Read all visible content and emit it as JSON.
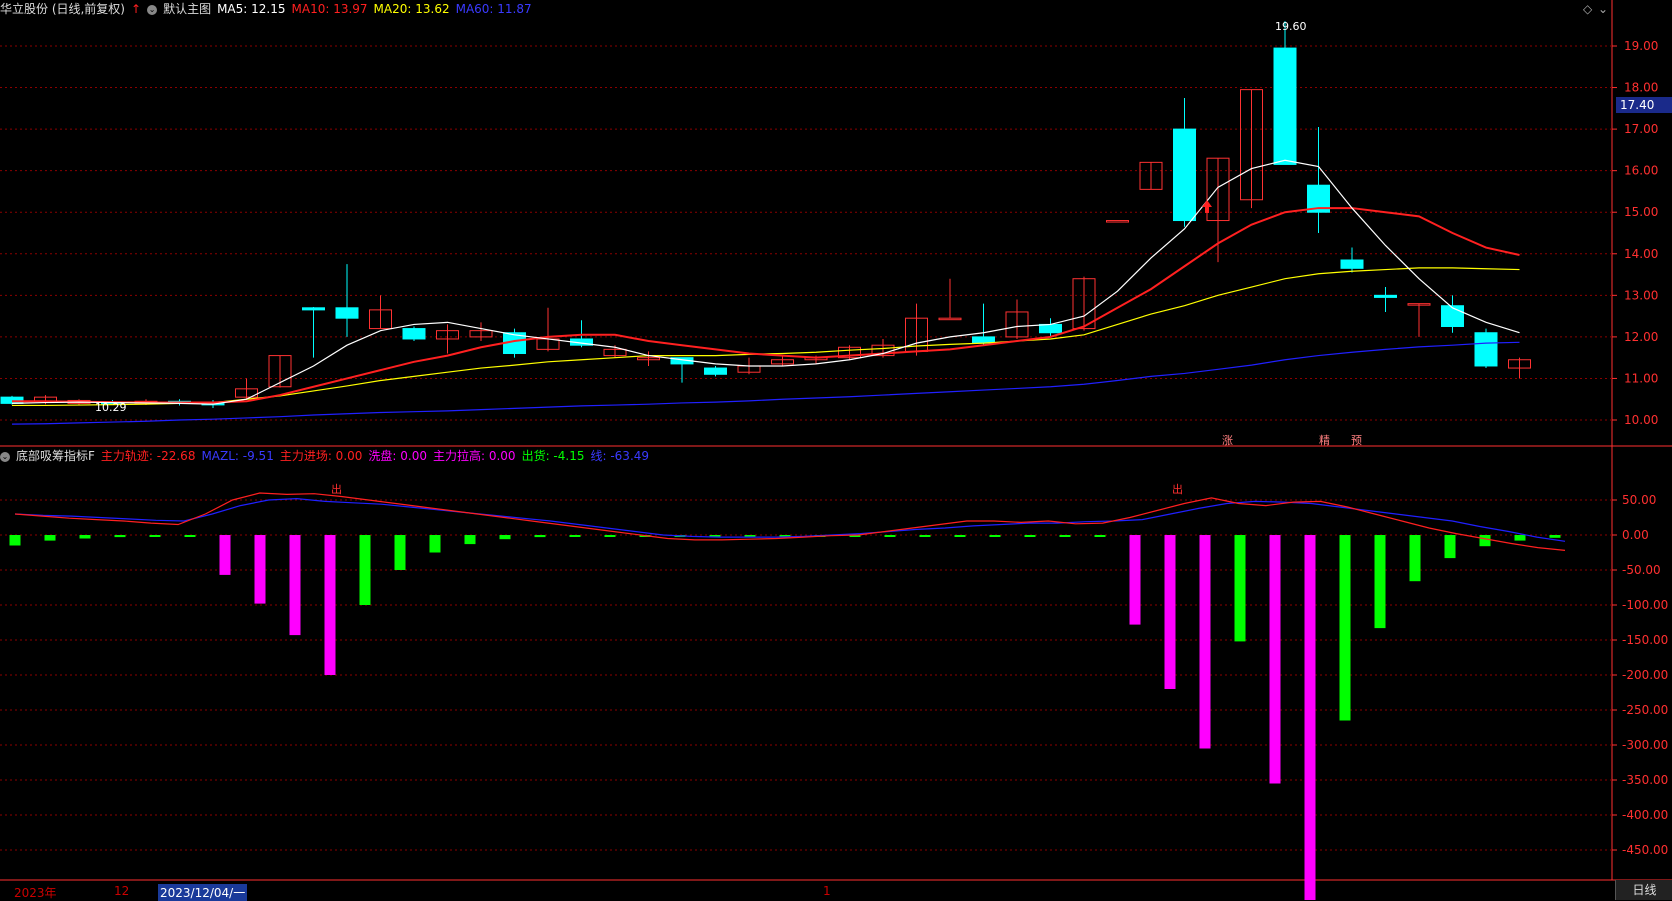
{
  "header": {
    "stock_name": "华立股份 (日线,前复权)",
    "chart_name": "默认主图",
    "ma5_label": "MA5: 12.15",
    "ma10_label": "MA10: 13.97",
    "ma20_label": "MA20: 13.62",
    "ma60_label": "MA60: 11.87"
  },
  "indicator_header": {
    "name": "底部吸筹指标F",
    "main_track": "主力轨迹: -22.68",
    "mazl": "MAZL: -9.51",
    "main_entry": "主力进场: 0.00",
    "wash": "洗盘: 0.00",
    "main_pull": "主力拉高: 0.00",
    "ship": "出货: -4.15",
    "line": "线: -63.49"
  },
  "x_axis": {
    "year": "2023年",
    "month": "12",
    "selected_date": "2023/12/04/一",
    "month2": "1"
  },
  "period_button": "日线",
  "price_marker": "17.40",
  "annotations": {
    "high": "19.60",
    "low": "10.29",
    "chu1": "出",
    "chu2": "出",
    "zhang": "涨",
    "jing": "精",
    "yu": "预"
  },
  "colors": {
    "up": "#ff3232",
    "down": "#00ffff",
    "ma5": "#ffffff",
    "ma10": "#ff2020",
    "ma20": "#ffff00",
    "ma60": "#2020ff",
    "magenta": "#ff00ff",
    "green": "#00ff00",
    "grid": "#8b0000",
    "axis": "#ff3030"
  },
  "chart_data": [
    {
      "type": "candlestick",
      "title": "华立股份 (日线,前复权)",
      "ylim": [
        9.7,
        19.6
      ],
      "y_ticks": [
        "19.00",
        "18.00",
        "17.00",
        "16.00",
        "15.00",
        "14.00",
        "13.00",
        "12.00",
        "11.00",
        "10.00"
      ],
      "candles": [
        [
          10.55,
          10.4,
          10.58,
          10.37
        ],
        [
          10.45,
          10.55,
          10.6,
          10.38
        ],
        [
          10.4,
          10.47,
          10.5,
          10.35
        ],
        [
          10.42,
          10.4,
          10.48,
          10.38
        ],
        [
          10.4,
          10.45,
          10.5,
          10.36
        ],
        [
          10.45,
          10.4,
          10.5,
          10.35
        ],
        [
          10.4,
          10.38,
          10.48,
          10.29
        ],
        [
          10.55,
          10.75,
          11.0,
          10.5
        ],
        [
          10.8,
          11.55,
          11.55,
          10.78
        ],
        [
          12.7,
          12.65,
          12.72,
          11.5
        ],
        [
          12.7,
          12.45,
          13.75,
          12.0
        ],
        [
          12.2,
          12.65,
          13.0,
          12.2
        ],
        [
          12.2,
          11.95,
          12.25,
          11.9
        ],
        [
          11.95,
          12.15,
          12.3,
          11.6
        ],
        [
          12.0,
          12.15,
          12.35,
          11.9
        ],
        [
          12.1,
          11.6,
          12.2,
          11.5
        ],
        [
          11.7,
          11.95,
          12.7,
          11.65
        ],
        [
          11.95,
          11.8,
          12.4,
          11.75
        ],
        [
          11.55,
          11.7,
          11.8,
          11.5
        ],
        [
          11.45,
          11.5,
          11.65,
          11.3
        ],
        [
          11.5,
          11.35,
          11.5,
          10.9
        ],
        [
          11.25,
          11.1,
          11.3,
          11.05
        ],
        [
          11.15,
          11.3,
          11.5,
          11.1
        ],
        [
          11.35,
          11.45,
          11.55,
          11.3
        ],
        [
          11.45,
          11.5,
          11.55,
          11.35
        ],
        [
          11.5,
          11.75,
          11.8,
          11.45
        ],
        [
          11.55,
          11.8,
          11.95,
          11.5
        ],
        [
          11.65,
          12.45,
          12.8,
          11.55
        ],
        [
          12.45,
          12.45,
          13.4,
          12.45
        ],
        [
          12.0,
          11.85,
          12.8,
          11.8
        ],
        [
          12.0,
          12.6,
          12.9,
          11.95
        ],
        [
          12.3,
          12.1,
          12.45,
          12.0
        ],
        [
          12.2,
          13.4,
          13.45,
          12.15
        ],
        [
          14.8,
          14.8,
          14.8,
          14.8
        ],
        [
          15.55,
          16.2,
          16.2,
          15.55
        ],
        [
          17.0,
          14.8,
          17.75,
          14.65
        ],
        [
          14.8,
          16.3,
          16.3,
          13.8
        ],
        [
          15.3,
          17.95,
          17.95,
          15.1
        ],
        [
          18.95,
          16.15,
          19.6,
          16.15
        ],
        [
          15.65,
          15.0,
          17.05,
          14.5
        ],
        [
          13.85,
          13.65,
          14.15,
          13.55
        ],
        [
          13.0,
          12.95,
          13.2,
          12.6
        ],
        [
          12.8,
          12.8,
          12.8,
          12.0
        ],
        [
          12.75,
          12.25,
          13.0,
          12.1
        ],
        [
          12.1,
          11.3,
          12.2,
          11.25
        ],
        [
          11.25,
          11.45,
          11.5,
          11.0
        ]
      ],
      "ma5": [
        10.4,
        10.42,
        10.43,
        10.42,
        10.41,
        10.4,
        10.38,
        10.5,
        10.9,
        11.3,
        11.8,
        12.15,
        12.3,
        12.35,
        12.2,
        12.05,
        11.95,
        11.85,
        11.75,
        11.55,
        11.45,
        11.35,
        11.3,
        11.3,
        11.35,
        11.45,
        11.6,
        11.85,
        12.0,
        12.1,
        12.25,
        12.3,
        12.5,
        13.1,
        13.9,
        14.6,
        15.6,
        16.05,
        16.25,
        16.1,
        15.1,
        14.2,
        13.4,
        12.7,
        12.35,
        12.1
      ],
      "ma10": [
        10.45,
        10.45,
        10.44,
        10.43,
        10.42,
        10.42,
        10.42,
        10.45,
        10.6,
        10.8,
        11.0,
        11.2,
        11.4,
        11.55,
        11.75,
        11.9,
        12.0,
        12.05,
        12.05,
        11.9,
        11.8,
        11.7,
        11.6,
        11.55,
        11.5,
        11.55,
        11.6,
        11.65,
        11.7,
        11.8,
        11.9,
        12.0,
        12.25,
        12.7,
        13.15,
        13.7,
        14.25,
        14.7,
        15.0,
        15.1,
        15.1,
        15.0,
        14.9,
        14.5,
        14.15,
        13.97
      ],
      "ma20": [
        10.35,
        10.35,
        10.36,
        10.37,
        10.38,
        10.4,
        10.42,
        10.5,
        10.58,
        10.7,
        10.82,
        10.95,
        11.05,
        11.15,
        11.25,
        11.32,
        11.4,
        11.45,
        11.5,
        11.55,
        11.55,
        11.55,
        11.58,
        11.6,
        11.63,
        11.68,
        11.72,
        11.78,
        11.82,
        11.85,
        11.9,
        11.95,
        12.05,
        12.3,
        12.55,
        12.75,
        13.0,
        13.2,
        13.4,
        13.52,
        13.58,
        13.62,
        13.66,
        13.66,
        13.64,
        13.62
      ],
      "ma60": [
        9.9,
        9.91,
        9.93,
        9.95,
        9.97,
        10.0,
        10.02,
        10.05,
        10.08,
        10.12,
        10.15,
        10.18,
        10.2,
        10.22,
        10.25,
        10.28,
        10.31,
        10.34,
        10.36,
        10.38,
        10.41,
        10.43,
        10.46,
        10.5,
        10.53,
        10.56,
        10.6,
        10.64,
        10.68,
        10.72,
        10.76,
        10.8,
        10.86,
        10.95,
        11.05,
        11.12,
        11.22,
        11.32,
        11.45,
        11.55,
        11.63,
        11.7,
        11.76,
        11.8,
        11.85,
        11.87
      ]
    },
    {
      "type": "bar",
      "title": "底部吸筹指标F",
      "ylim": [
        -530,
        85
      ],
      "y_ticks": [
        "50.00",
        "0.00",
        "-50.00",
        "-100.00",
        "-150.00",
        "-200.00",
        "-250.00",
        "-300.00",
        "-350.00",
        "-400.00",
        "-450.00"
      ],
      "bars": [
        {
          "v": -15,
          "c": "green"
        },
        {
          "v": -8,
          "c": "green"
        },
        {
          "v": -5,
          "c": "green"
        },
        {
          "v": -3,
          "c": "green"
        },
        {
          "v": -2,
          "c": "green"
        },
        {
          "v": -1,
          "c": "green"
        },
        {
          "v": -57,
          "c": "magenta"
        },
        {
          "v": -98,
          "c": "magenta"
        },
        {
          "v": -143,
          "c": "magenta"
        },
        {
          "v": -200,
          "c": "magenta"
        },
        {
          "v": -100,
          "c": "green"
        },
        {
          "v": -50,
          "c": "green"
        },
        {
          "v": -25,
          "c": "green"
        },
        {
          "v": -13,
          "c": "green"
        },
        {
          "v": -6,
          "c": "green"
        },
        {
          "v": -3,
          "c": "green"
        },
        {
          "v": -1,
          "c": "green"
        },
        {
          "v": -1,
          "c": "green"
        },
        {
          "v": -1,
          "c": "green"
        },
        {
          "v": -1,
          "c": "green"
        },
        {
          "v": -1,
          "c": "green"
        },
        {
          "v": -1,
          "c": "green"
        },
        {
          "v": -1,
          "c": "green"
        },
        {
          "v": -1,
          "c": "green"
        },
        {
          "v": -1,
          "c": "green"
        },
        {
          "v": -1,
          "c": "green"
        },
        {
          "v": -1,
          "c": "green"
        },
        {
          "v": -1,
          "c": "green"
        },
        {
          "v": -1,
          "c": "green"
        },
        {
          "v": -1,
          "c": "green"
        },
        {
          "v": -1,
          "c": "green"
        },
        {
          "v": -1,
          "c": "green"
        },
        {
          "v": -128,
          "c": "magenta"
        },
        {
          "v": -220,
          "c": "magenta"
        },
        {
          "v": -305,
          "c": "magenta"
        },
        {
          "v": -152,
          "c": "green"
        },
        {
          "v": -355,
          "c": "magenta"
        },
        {
          "v": -530,
          "c": "magenta"
        },
        {
          "v": -265,
          "c": "green"
        },
        {
          "v": -133,
          "c": "green"
        },
        {
          "v": -66,
          "c": "green"
        },
        {
          "v": -33,
          "c": "green"
        },
        {
          "v": -16,
          "c": "green"
        },
        {
          "v": -8,
          "c": "green"
        },
        {
          "v": -4,
          "c": "green"
        }
      ],
      "line_red": [
        30,
        27,
        24,
        22,
        20,
        17,
        15,
        30,
        50,
        60,
        58,
        59,
        55,
        50,
        45,
        40,
        35,
        30,
        25,
        20,
        15,
        10,
        5,
        0,
        -5,
        -7,
        -7,
        -6,
        -5,
        -3,
        -1,
        0,
        5,
        10,
        15,
        20,
        20,
        18,
        20,
        16,
        17,
        25,
        35,
        45,
        53,
        45,
        42,
        47,
        48,
        40,
        30,
        20,
        10,
        2,
        -5,
        -12,
        -18,
        -22
      ],
      "line_blue": [
        30,
        28,
        27,
        25,
        23,
        21,
        20,
        30,
        42,
        50,
        52,
        48,
        46,
        44,
        40,
        36,
        32,
        28,
        24,
        20,
        15,
        10,
        5,
        0,
        -2,
        -3,
        -3,
        -3,
        -2,
        0,
        2,
        5,
        8,
        10,
        13,
        15,
        17,
        17,
        19,
        20,
        22,
        30,
        38,
        45,
        48,
        47,
        45,
        40,
        35,
        30,
        25,
        20,
        12,
        5,
        -3,
        -9
      ]
    }
  ]
}
